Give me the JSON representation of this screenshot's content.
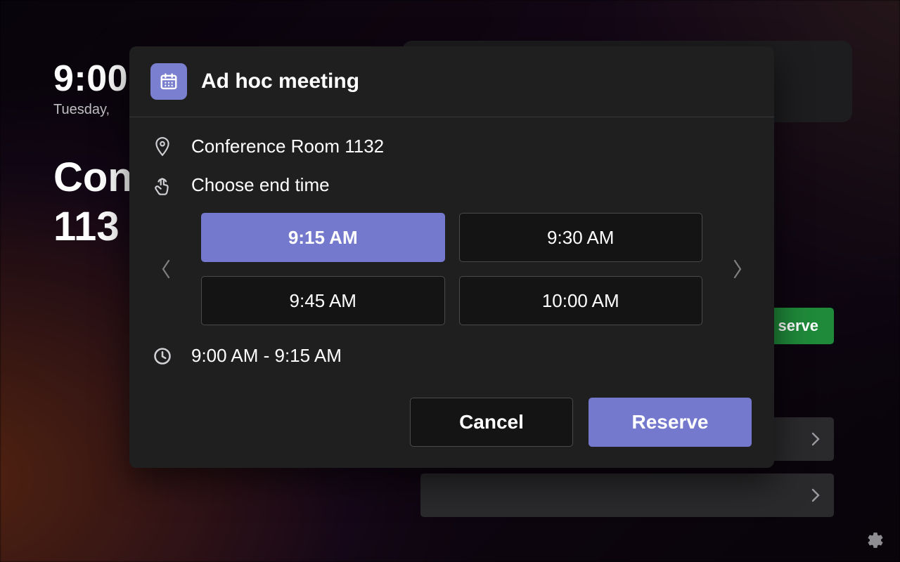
{
  "background": {
    "time": "9:00",
    "date": "Tuesday,",
    "room_line1": "Con",
    "room_line2": "113",
    "reserve_bg_label": "serve"
  },
  "modal": {
    "title": "Ad hoc meeting",
    "room": "Conference Room 1132",
    "choose_label": "Choose end time",
    "time_slots": [
      "9:15 AM",
      "9:30 AM",
      "9:45 AM",
      "10:00 AM"
    ],
    "selected_index": 0,
    "summary": "9:00 AM - 9:15 AM",
    "cancel_label": "Cancel",
    "reserve_label": "Reserve"
  },
  "colors": {
    "accent": "#7479cd",
    "modal_bg": "#1f1f1f",
    "slot_border": "#4a4a4c"
  }
}
